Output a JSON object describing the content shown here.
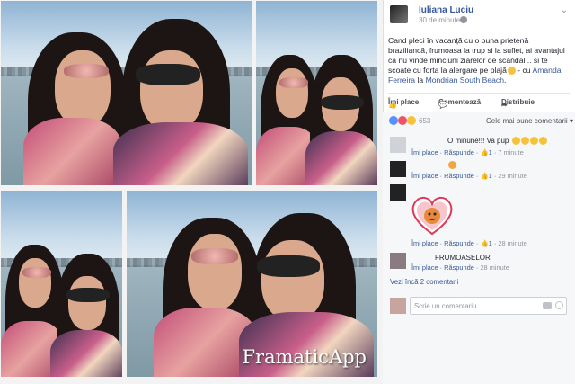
{
  "post": {
    "author": "Iuliana Luciu",
    "time": "30 de minute",
    "text_main": "Cand pleci în vacanță cu o buna prietenă braziliancă, frumoasa la trup si la suflet, ai avantajul că nu vinde minciuni ziarelor de scandal... si te scoate cu forta la alergare pe plajă",
    "text_with": " - cu ",
    "tag_person": "Amanda Ferreira",
    "text_at": " la ",
    "tag_place": "Mondrian South Beach",
    "text_end": "."
  },
  "photos": {
    "watermark": "FramaticApp"
  },
  "actions": {
    "like": "Îmi place",
    "comment": "Comentează",
    "share": "Distribuie"
  },
  "reactions": {
    "count": "653",
    "sort_label": "Cele mai bune comentarii"
  },
  "comments": [
    {
      "text": "O minune!!! Va pup",
      "like": "Îmi place",
      "reply": "Răspunde",
      "likes": "1",
      "time": "7 minute"
    },
    {
      "text": "",
      "like": "Îmi place",
      "reply": "Răspunde",
      "likes": "1",
      "time": "29 minute"
    },
    {
      "text": "",
      "like": "Îmi place",
      "reply": "Răspunde",
      "likes": "1",
      "time": "28 minute"
    },
    {
      "text": "FRUMOASELOR",
      "like": "Îmi place",
      "reply": "Răspunde",
      "likes": "",
      "time": "28 minute"
    }
  ],
  "more_comments": "Vezi încă 2 comentarii",
  "write_comment": {
    "placeholder": "Scrie un comentariu..."
  },
  "colors": {
    "link": "#365899",
    "meta": "#90949c",
    "like_blue": "#5890ff",
    "love_red": "#f25268",
    "wow_yellow": "#f5c33b"
  },
  "icons": [
    "globe-icon",
    "like-icon",
    "comment-icon",
    "share-icon",
    "like-reaction-icon",
    "love-reaction-icon",
    "wow-reaction-icon",
    "camera-icon",
    "smiley-icon",
    "chevron-down-icon"
  ]
}
